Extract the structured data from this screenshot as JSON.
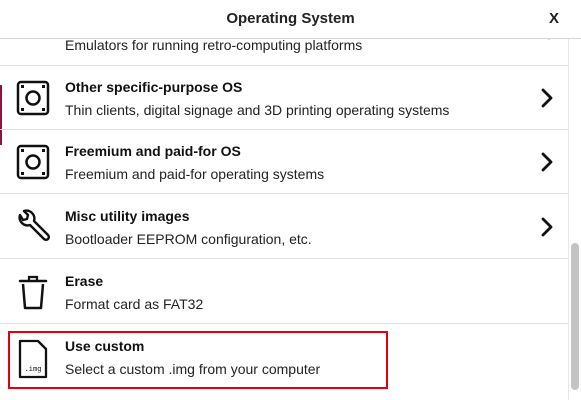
{
  "dialog": {
    "title": "Operating System",
    "close_label": "X"
  },
  "items": [
    {
      "title": "",
      "description": "Emulators for running retro-computing platforms",
      "icon": "sd-card-icon",
      "has_submenu": true
    },
    {
      "title": "Other specific-purpose OS",
      "description": "Thin clients, digital signage and 3D printing operating systems",
      "icon": "sd-card-icon",
      "has_submenu": true
    },
    {
      "title": "Freemium and paid-for OS",
      "description": "Freemium and paid-for operating systems",
      "icon": "sd-card-icon",
      "has_submenu": true
    },
    {
      "title": "Misc utility images",
      "description": "Bootloader EEPROM configuration, etc.",
      "icon": "wrench-icon",
      "has_submenu": true
    },
    {
      "title": "Erase",
      "description": "Format card as FAT32",
      "icon": "trash-icon",
      "has_submenu": false
    },
    {
      "title": "Use custom",
      "description": "Select a custom .img from your computer",
      "icon": "img-file-icon",
      "icon_label": ".img",
      "has_submenu": false
    }
  ],
  "colors": {
    "highlight_border": "#e3000f",
    "accent": "#8a1538"
  }
}
